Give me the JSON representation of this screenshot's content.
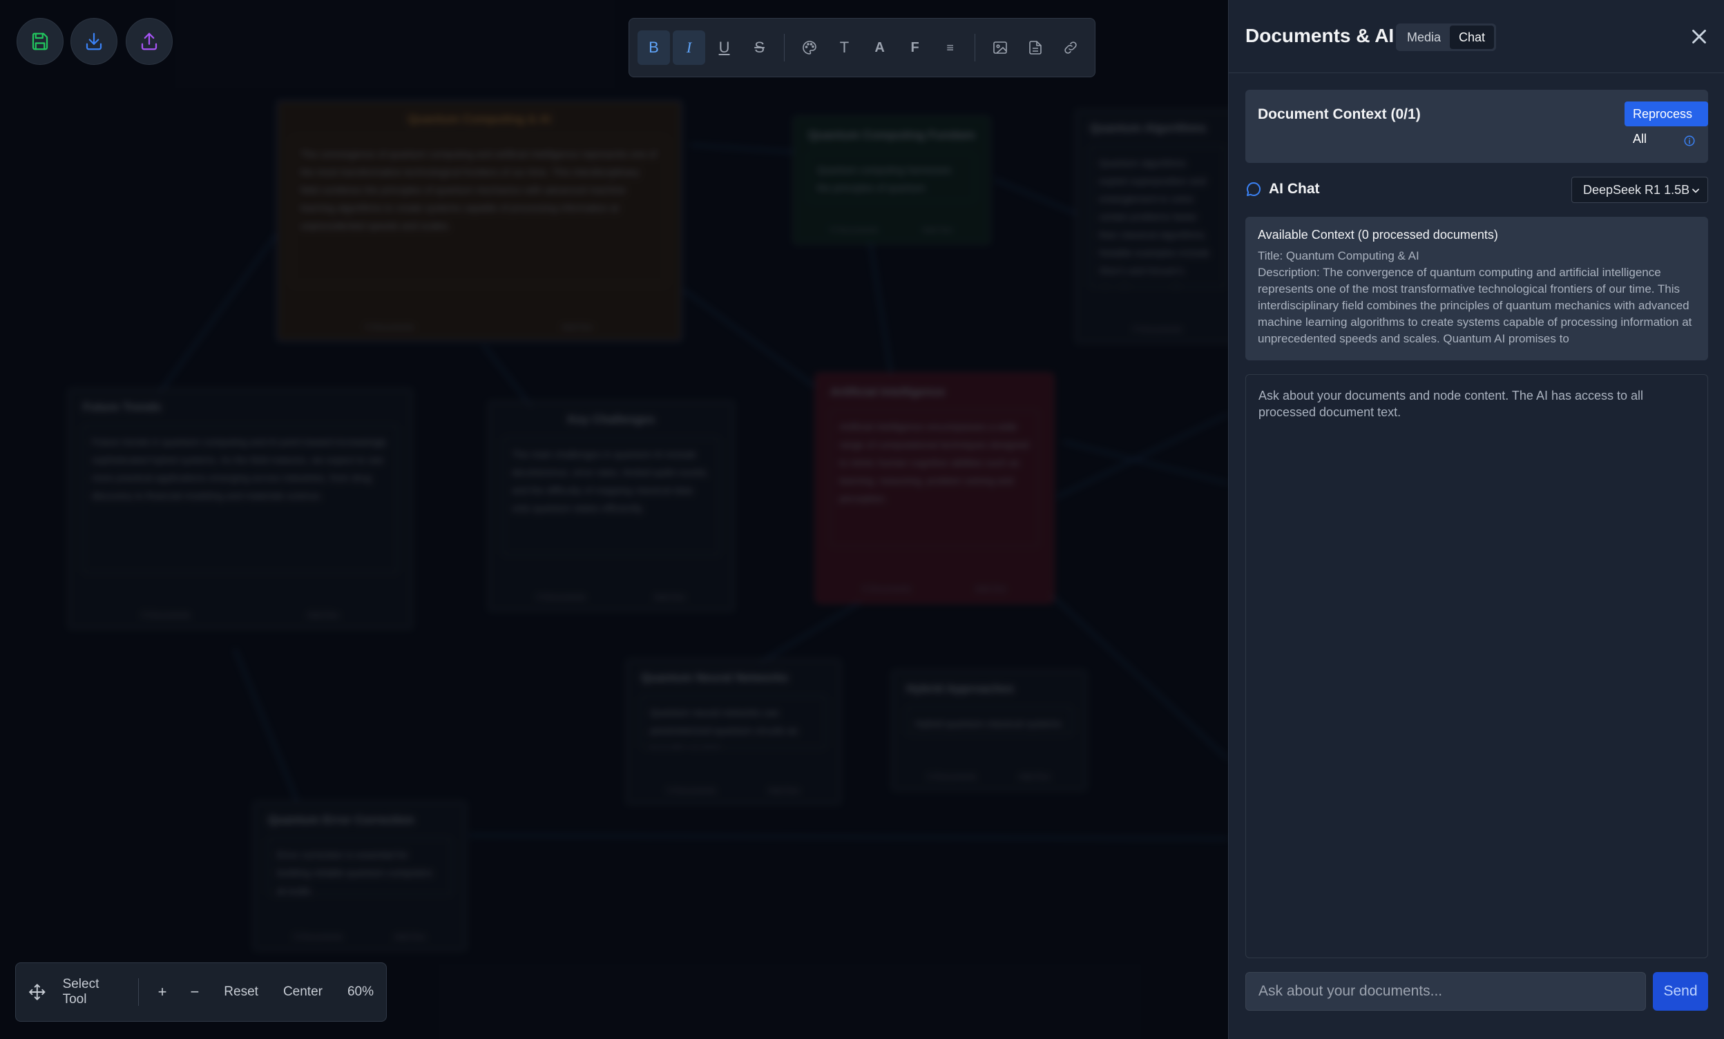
{
  "canvas": {
    "nodes": [
      {
        "title": "Quantum Computing & AI",
        "body": "The convergence of quantum computing and artificial intelligence represents one of the most transformative technological frontiers of our time. This interdisciplinary field combines the principles of quantum mechanics with advanced machine learning algorithms to create systems capable of processing information at unprecedented speeds and scales.",
        "foot_left": "0 Documents",
        "foot_right": "Add Doc"
      },
      {
        "title": "Quantum Computing Fundamentals",
        "body": "Quantum computing harnesses the principles of quantum mechanics.",
        "foot_left": "0 Documents",
        "foot_right": "Add Doc"
      },
      {
        "title": "Quantum Algorithms",
        "body": "Quantum algorithms exploit superposition and entanglement to solve certain problems faster than classical algorithms. Notable examples include Shor's and Grover's algorithms, as well as newer quantum machine learning approaches.",
        "foot_left": "0 Documents",
        "foot_right": "Add Doc"
      },
      {
        "title": "Future Trends",
        "body": "Future trends in quantum computing and AI point toward increasingly sophisticated hybrid systems. As the field matures, we expect to see more practical applications emerging across industries, from drug discovery to financial modeling and materials science.",
        "foot_left": "0 Documents",
        "foot_right": "Add Doc"
      },
      {
        "title": "Key Challenges",
        "body": "The main challenges in quantum AI include decoherence, error rates, limited qubit counts, and the difficulty of mapping classical data onto quantum states efficiently.",
        "foot_left": "0 Documents",
        "foot_right": "Add Doc"
      },
      {
        "title": "Artificial Intelligence",
        "body": "Artificial intelligence encompasses a wide range of computational techniques designed to mimic human cognitive abilities such as learning, reasoning, problem solving and perception.",
        "foot_left": "0 Documents",
        "foot_right": "Add Doc"
      },
      {
        "title": "Quantum Neural Networks",
        "body": "Quantum neural networks use parameterized quantum circuits as trainable models.",
        "foot_left": "0 Documents",
        "foot_right": "Add Doc"
      },
      {
        "title": "Hybrid Approaches",
        "body": "Hybrid quantum-classical systems combine the strengths of both paradigms.",
        "foot_left": "0 Documents",
        "foot_right": "Add Doc"
      },
      {
        "title": "Quantum Error Correction",
        "body": "Error correction is essential for building reliable quantum computers at scale.",
        "foot_left": "0 Documents",
        "foot_right": "Add Doc"
      }
    ]
  },
  "file_actions": {
    "save": "save-icon",
    "download": "download-icon",
    "upload": "upload-icon"
  },
  "toolbar": {
    "bold": "B",
    "italic": "I",
    "underline": "U",
    "strike": "S",
    "text": "T",
    "font_color": "A",
    "font_family": "F",
    "align": "≡"
  },
  "zoom_bar": {
    "select_tool": "Select Tool",
    "zoom_in": "+",
    "zoom_out": "−",
    "reset": "Reset",
    "center": "Center",
    "zoom_level": "60%"
  },
  "panel": {
    "title": "Documents & AI",
    "tabs": [
      {
        "label": "Media",
        "active": false
      },
      {
        "label": "Chat",
        "active": true
      }
    ],
    "document_context": {
      "title": "Document Context (0/1)",
      "reprocess_label": "Reprocess All"
    },
    "ai_chat": {
      "label": "AI Chat",
      "model": "DeepSeek R1 1.5B"
    },
    "available_context": {
      "title": "Available Context (0 processed documents)",
      "doc_title": "Title: Quantum Computing & AI",
      "doc_description": "Description: The convergence of quantum computing and artificial intelligence represents one of the most transformative technological frontiers of our time. This interdisciplinary field combines the principles of quantum mechanics with advanced machine learning algorithms to create systems capable of processing information at unprecedented speeds and scales. Quantum AI promises to"
    },
    "chat_hint": "Ask about your documents and node content. The AI has access to all processed document text.",
    "input_placeholder": "Ask about your documents...",
    "send_label": "Send"
  },
  "colors": {
    "accent": "#2563eb",
    "send_button": "#1d4ed8",
    "save_icon": "#22c55e",
    "download_icon": "#3b82f6",
    "upload_icon": "#a855f7",
    "active_tool": "#60a5fa"
  }
}
